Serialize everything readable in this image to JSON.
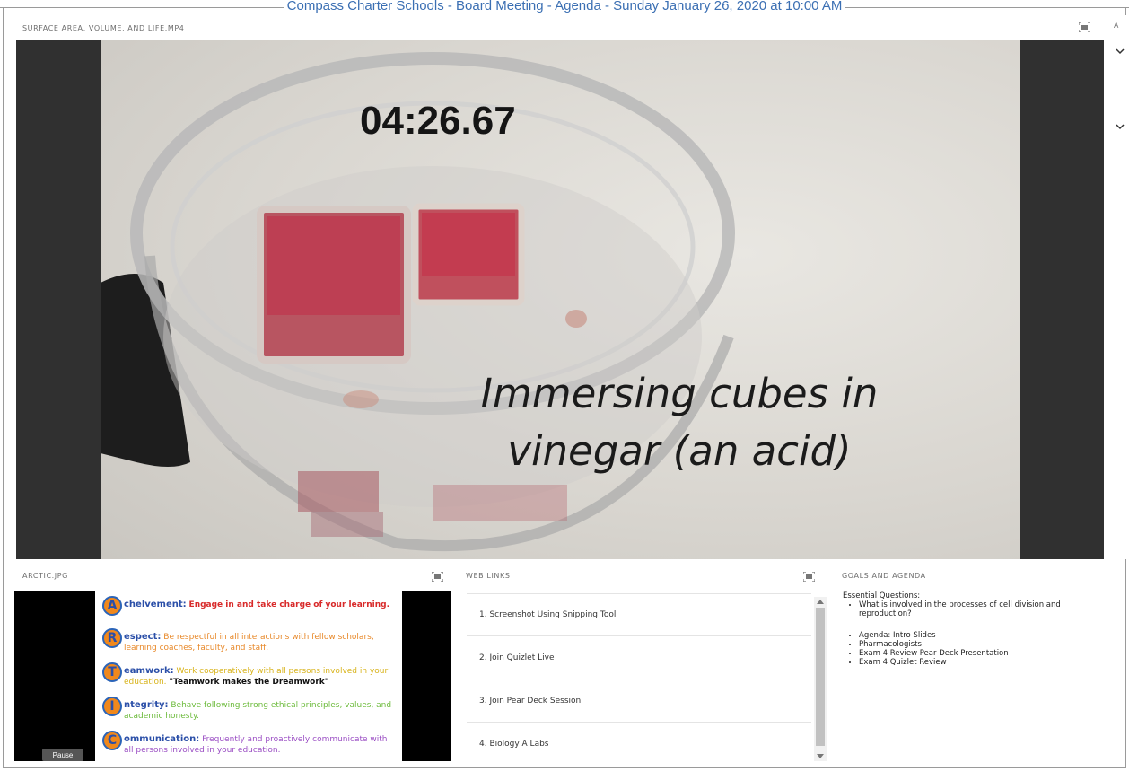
{
  "window": {
    "title": "Compass Charter Schools - Board Meeting - Agenda - Sunday January 26, 2020 at 10:00 AM"
  },
  "video_pod": {
    "title": "SURFACE AREA, VOLUME, AND LIFE.MP4",
    "timer": "04:26.67",
    "caption": "Immersing cubes in vinegar (an acid)"
  },
  "side_strip": {
    "label": "A"
  },
  "arctic_pod": {
    "title": "ARCTIC.JPG",
    "pause_label": "Pause",
    "values": [
      {
        "letter": "A",
        "word": "chelvement:",
        "text": "Engage in and take charge of your learning.",
        "color": "#d82a2a"
      },
      {
        "letter": "R",
        "word": "espect:",
        "text": "Be respectful in all interactions with fellow scholars, learning coaches, faculty, and staff.",
        "color": "#e8892a"
      },
      {
        "letter": "T",
        "word": "eamwork:",
        "text": "Work cooperatively with all persons involved in your education.",
        "quote": "\"Teamwork makes the Dreamwork\"",
        "color": "#e6c21e"
      },
      {
        "letter": "I",
        "word": "ntegrity:",
        "text": "Behave following strong ethical principles, values, and academic honesty.",
        "color": "#6dbb3c"
      },
      {
        "letter": "C",
        "word": "ommunication:",
        "text": "Frequently and proactively communicate with all persons involved in your education.",
        "color": "#9b4fc4"
      }
    ]
  },
  "links_pod": {
    "title": "WEB LINKS",
    "links": [
      "1. Screenshot Using Snipping Tool",
      "2. Join Quizlet Live",
      "3. Join Pear Deck Session",
      "4. Biology A Labs"
    ]
  },
  "goals_pod": {
    "title": "GOALS AND AGENDA",
    "heading": "Essential Questions:",
    "questions": [
      "What is involved in the processes of cell division and reproduction?"
    ],
    "agenda": [
      "Agenda: Intro Slides",
      "Pharmacologists",
      "Exam 4 Review Pear Deck Presentation",
      "Exam 4 Quizlet Review"
    ]
  }
}
